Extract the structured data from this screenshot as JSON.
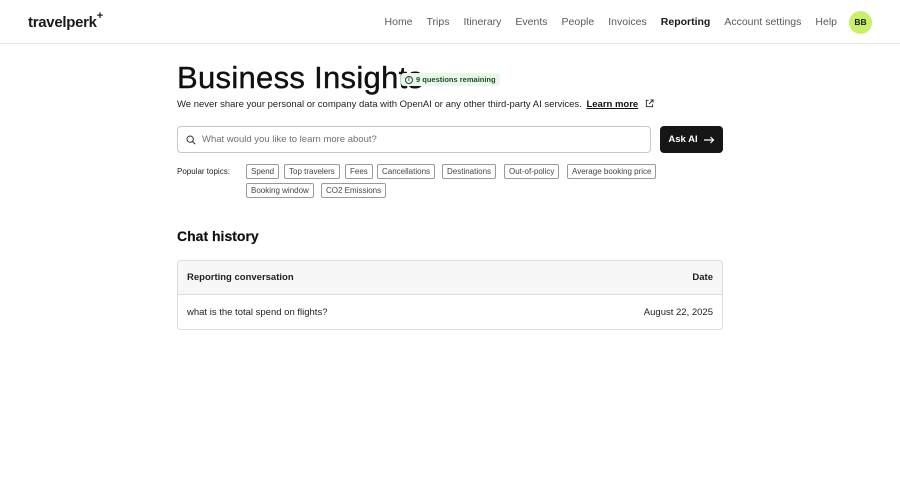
{
  "brand": {
    "logo_text": "travelperk",
    "logo_mark": "+"
  },
  "nav": {
    "items": [
      "Home",
      "Trips",
      "Itinerary",
      "Events",
      "People",
      "Invoices",
      "Reporting",
      "Account settings",
      "Help"
    ],
    "active": "Reporting",
    "avatar_initials": "BB"
  },
  "page": {
    "title": "Business Insights",
    "questions_badge": "9 questions remaining",
    "disclaimer": "We never share your personal or company data with OpenAI or any other third-party AI services.",
    "learn_more": "Learn more"
  },
  "search": {
    "placeholder": "What would you like to learn more about?",
    "button_label": "Ask AI"
  },
  "topics": {
    "label": "Popular topics:",
    "items": [
      "Spend",
      "Top travelers",
      "Fees",
      "Cancellations",
      "Destinations",
      "Out-of-policy",
      "Average booking price",
      "Booking window",
      "CO2 Emissions"
    ]
  },
  "chat_history": {
    "heading": "Chat history",
    "columns": [
      "Reporting conversation",
      "Date"
    ],
    "rows": [
      {
        "conversation": "what is the total spend on flights?",
        "date": "August 22, 2025"
      }
    ]
  },
  "colors": {
    "accent_avatar": "#c9f06b",
    "badge_bg": "#e9f8ea",
    "button_bg": "#161616"
  }
}
